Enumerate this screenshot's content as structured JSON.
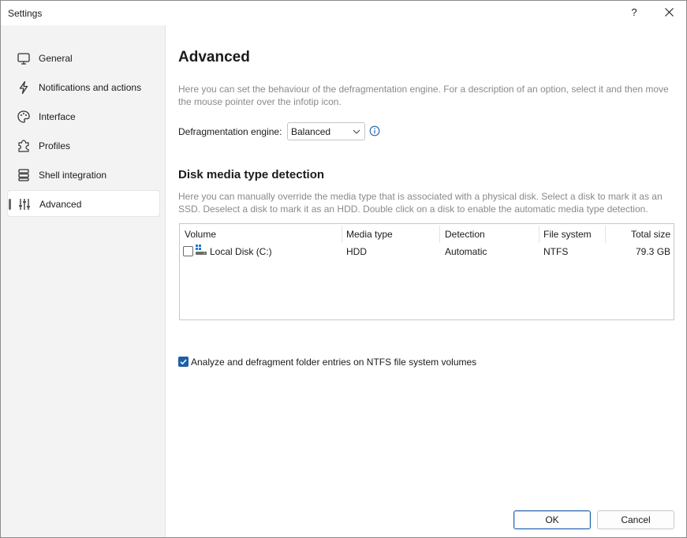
{
  "window": {
    "title": "Settings",
    "help_glyph": "?",
    "close_glyph": "✕"
  },
  "sidebar": {
    "items": [
      {
        "label": "General",
        "icon": "monitor-icon",
        "active": false
      },
      {
        "label": "Notifications and actions",
        "icon": "lightning-icon",
        "active": false
      },
      {
        "label": "Interface",
        "icon": "palette-icon",
        "active": false
      },
      {
        "label": "Profiles",
        "icon": "puzzle-icon",
        "active": false
      },
      {
        "label": "Shell integration",
        "icon": "layers-icon",
        "active": false
      },
      {
        "label": "Advanced",
        "icon": "sliders-icon",
        "active": true
      }
    ]
  },
  "main": {
    "title": "Advanced",
    "description": "Here you can set the behaviour of the defragmentation engine. For a description of an option, select it and then move the mouse pointer over the infotip icon.",
    "engine": {
      "label": "Defragmentation engine:",
      "value": "Balanced",
      "info_icon": "info-icon"
    },
    "disk_section": {
      "title": "Disk media type detection",
      "description": "Here you can manually override the media type that is associated with a physical disk. Select a disk to mark it as an SSD. Deselect a disk to mark it as an HDD. Double click on a disk to enable the automatic media type detection.",
      "columns": [
        "Volume",
        "Media type",
        "Detection",
        "File system",
        "Total size"
      ],
      "rows": [
        {
          "volume": "Local Disk (C:)",
          "media_type": "HDD",
          "detection": "Automatic",
          "file_system": "NTFS",
          "total_size": "79.3 GB",
          "checked": false
        }
      ]
    },
    "folder_option": {
      "label": "Analyze and defragment folder entries on NTFS file system volumes",
      "checked": true
    }
  },
  "buttons": {
    "ok": "OK",
    "cancel": "Cancel"
  },
  "colors": {
    "accent": "#1f5fa8",
    "sidebar_bg": "#f3f3f3",
    "muted_text": "#8a8a8a"
  }
}
